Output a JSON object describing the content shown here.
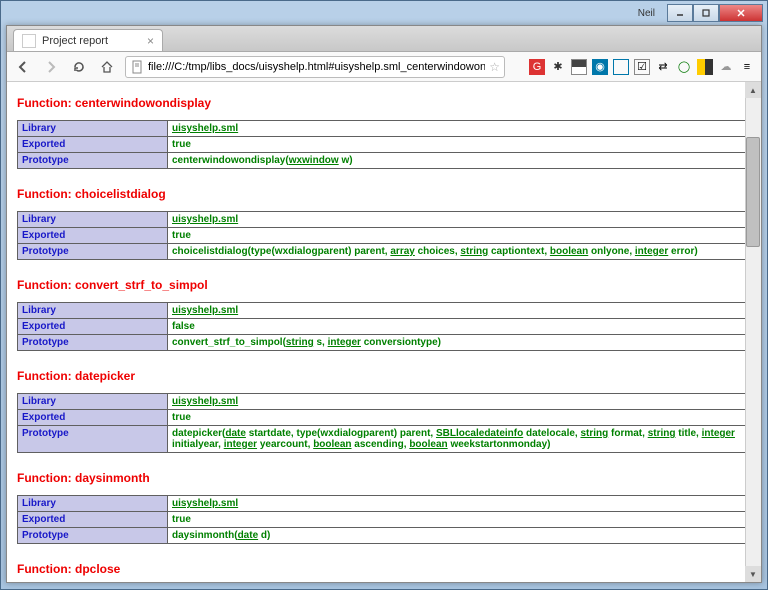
{
  "window": {
    "user_label": "Neil"
  },
  "browser": {
    "tab_title": "Project report",
    "url": "file:///C:/tmp/libs_docs/uisyshelp.html#uisyshelp.sml_centerwindowondi"
  },
  "labels": {
    "library": "Library",
    "exported": "Exported",
    "prototype": "Prototype"
  },
  "functions": [
    {
      "title": "Function: centerwindowondisplay",
      "library": "uisyshelp.sml",
      "exported": "true",
      "prototype_html": "centerwindowondisplay(<a class='type-link'>wxwindow</a> w)"
    },
    {
      "title": "Function: choicelistdialog",
      "library": "uisyshelp.sml",
      "exported": "true",
      "prototype_html": "choicelistdialog(type(wxdialogparent) parent, <a class='type-link'>array</a> choices, <a class='type-link'>string</a> captiontext, <a class='type-link'>boolean</a> onlyone, <a class='type-link'>integer</a> error)"
    },
    {
      "title": "Function: convert_strf_to_simpol",
      "library": "uisyshelp.sml",
      "exported": "false",
      "prototype_html": "convert_strf_to_simpol(<a class='type-link'>string</a> s, <a class='type-link'>integer</a> conversiontype)"
    },
    {
      "title": "Function: datepicker",
      "library": "uisyshelp.sml",
      "exported": "true",
      "prototype_html": "datepicker(<a class='type-link'>date</a> startdate, type(wxdialogparent) parent, <a class='type-link'>SBLlocaledateinfo</a> datelocale, <a class='type-link'>string</a> format, <a class='type-link'>string</a> title, <a class='type-link'>integer</a> initialyear, <a class='type-link'>integer</a> yearcount, <a class='type-link'>boolean</a> ascending, <a class='type-link'>boolean</a> weekstartonmonday)"
    },
    {
      "title": "Function: daysinmonth",
      "library": "uisyshelp.sml",
      "exported": "true",
      "prototype_html": "daysinmonth(<a class='type-link'>date</a> d)"
    },
    {
      "title": "Function: dpclose",
      "library": "",
      "exported": "",
      "prototype_html": ""
    }
  ]
}
